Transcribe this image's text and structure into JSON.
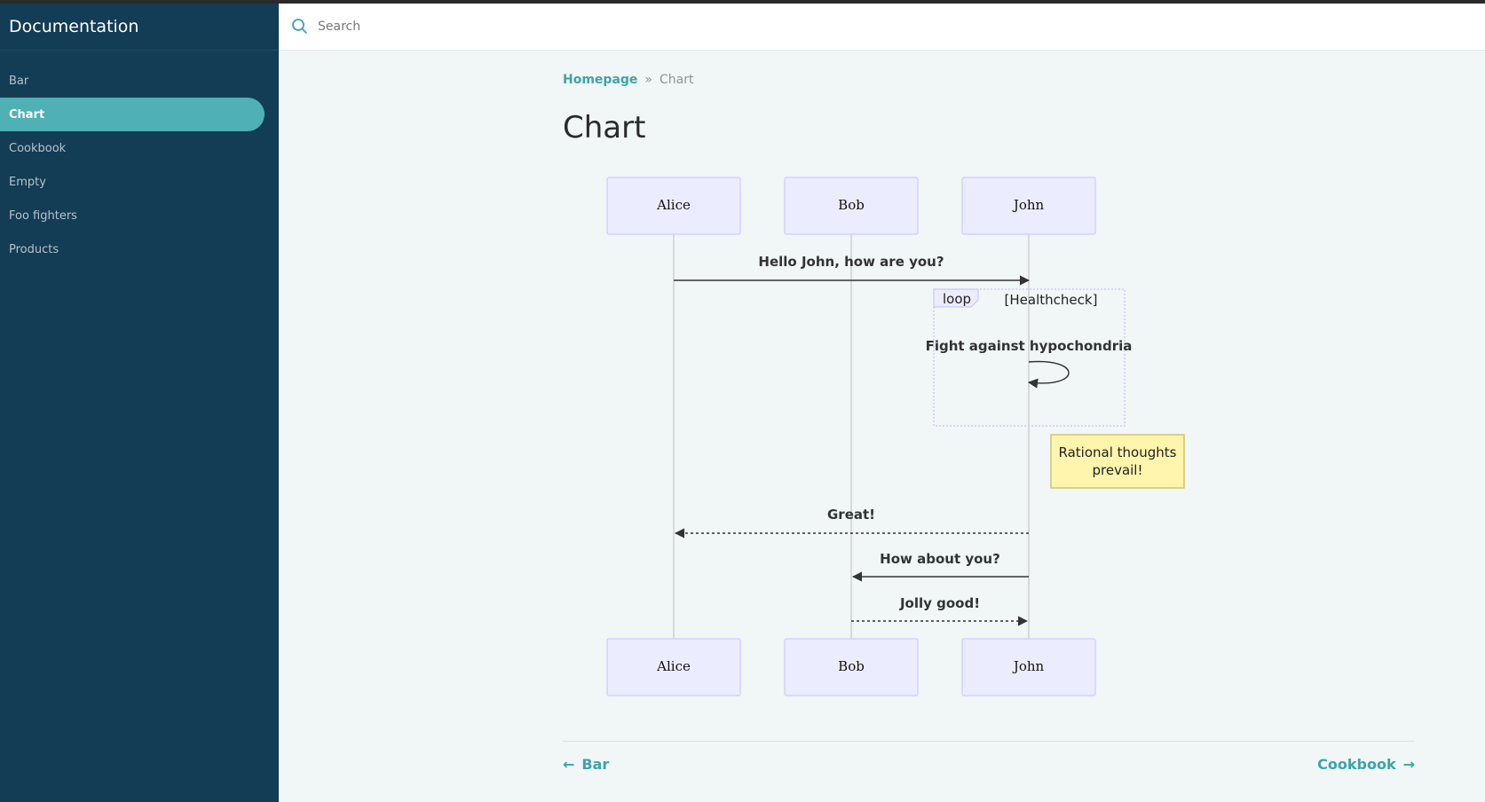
{
  "app": {
    "title": "Documentation"
  },
  "sidebar": {
    "items": [
      {
        "label": "Bar",
        "active": false
      },
      {
        "label": "Chart",
        "active": true
      },
      {
        "label": "Cookbook",
        "active": false
      },
      {
        "label": "Empty",
        "active": false
      },
      {
        "label": "Foo fighters",
        "active": false
      },
      {
        "label": "Products",
        "active": false
      }
    ]
  },
  "search": {
    "placeholder": "Search",
    "value": ""
  },
  "breadcrumb": {
    "home": "Homepage",
    "separator": "»",
    "current": "Chart"
  },
  "page": {
    "title": "Chart"
  },
  "diagram": {
    "actors": [
      "Alice",
      "Bob",
      "John"
    ],
    "messages": [
      {
        "text": "Hello John, how are you?"
      },
      {
        "text": "Fight against hypochondria"
      },
      {
        "text": "Great!"
      },
      {
        "text": "How about you?"
      },
      {
        "text": "Jolly good!"
      }
    ],
    "loop": {
      "label": "loop",
      "condition": "[Healthcheck]"
    },
    "note": {
      "line1": "Rational thoughts",
      "line2": "prevail!"
    }
  },
  "pager": {
    "prev": "Bar",
    "next": "Cookbook"
  },
  "colors": {
    "sidebar_bg": "#133c55",
    "accent": "#4fb0b6",
    "link": "#3ea3aa",
    "actor_fill": "#ececff",
    "actor_stroke": "#ccccff",
    "note_fill": "#fff5ad",
    "note_stroke": "#c9b84e"
  },
  "icons": {
    "search": "search-icon",
    "prev": "arrow-left-icon",
    "next": "arrow-right-icon"
  }
}
